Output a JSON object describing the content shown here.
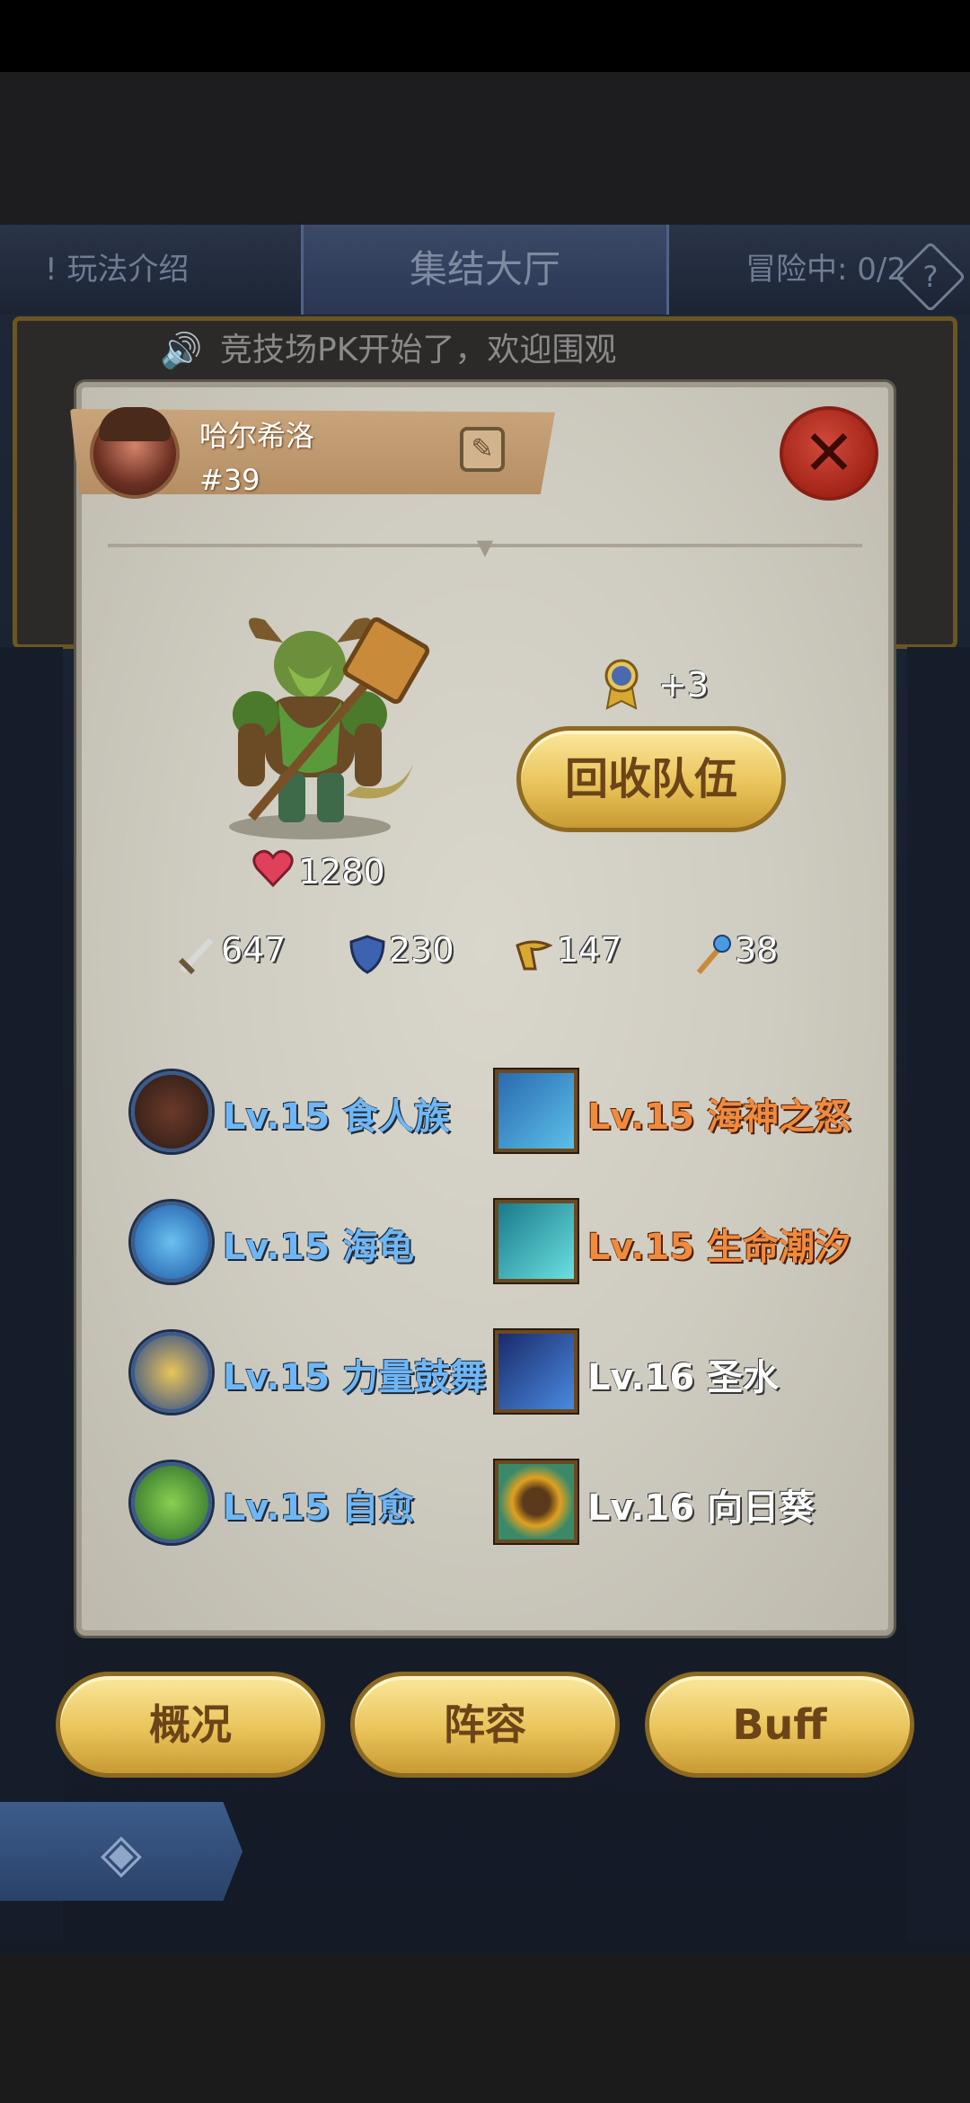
{
  "header": {
    "left_label": "玩法介绍",
    "title": "集结大厅",
    "right_label": "冒险中: 0/2",
    "help_icon": "?"
  },
  "marquee": {
    "text": "竞技场PK开始了，欢迎围观"
  },
  "player": {
    "name": "哈尔希洛",
    "id": "#39"
  },
  "hero": {
    "hp": "1280",
    "medal_bonus": "+3",
    "recall_button": "回收队伍"
  },
  "stats": [
    {
      "icon": "sword-icon",
      "value": "647"
    },
    {
      "icon": "shield-icon",
      "value": "230"
    },
    {
      "icon": "wing-boot-icon",
      "value": "147"
    },
    {
      "icon": "staff-icon",
      "value": "38"
    }
  ],
  "skills_left": [
    {
      "text": "Lv.15 食人族",
      "color": "#6fb6f4",
      "icon": "cannibal-icon"
    },
    {
      "text": "Lv.15 海龟",
      "color": "#6fb6f4",
      "icon": "turtle-icon"
    },
    {
      "text": "Lv.15 力量鼓舞",
      "color": "#6fb6f4",
      "icon": "banner-icon"
    },
    {
      "text": "Lv.15 自愈",
      "color": "#6fb6f4",
      "icon": "leaf-icon"
    }
  ],
  "skills_right": [
    {
      "text": "Lv.15 海神之怒",
      "color": "#f08a3c",
      "icon": "poseidon-icon"
    },
    {
      "text": "Lv.15 生命潮汐",
      "color": "#f08a3c",
      "icon": "wave-icon"
    },
    {
      "text": "Lv.16 圣水",
      "color": "#ffffff",
      "icon": "holy-water-icon"
    },
    {
      "text": "Lv.16 向日葵",
      "color": "#ffffff",
      "icon": "sunflower-icon"
    }
  ],
  "tabs": {
    "overview": "概况",
    "lineup": "阵容",
    "buff": "Buff"
  }
}
